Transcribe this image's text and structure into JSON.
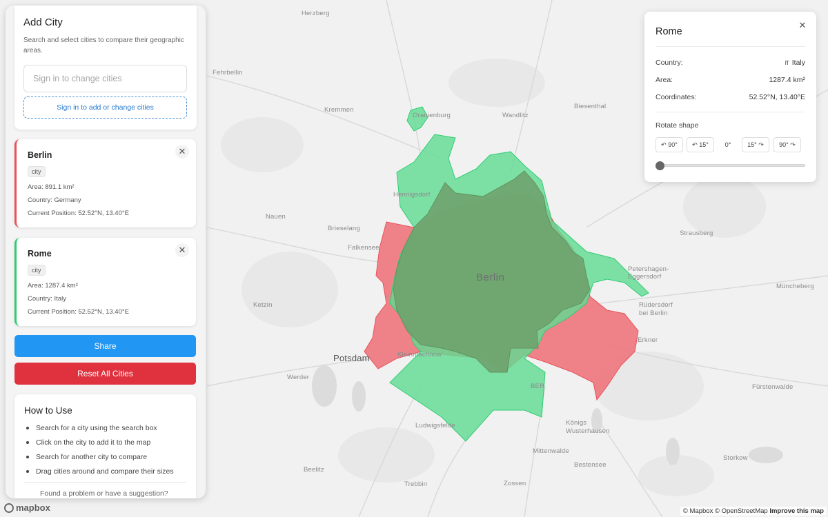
{
  "map": {
    "places": [
      {
        "name": "Herzberg",
        "cls": "place"
      },
      {
        "name": "Fehrbellin",
        "cls": "place"
      },
      {
        "name": "Kremmen",
        "cls": "place"
      },
      {
        "name": "Oranienburg",
        "cls": "place"
      },
      {
        "name": "Wandlitz",
        "cls": "place"
      },
      {
        "name": "Biesenthal",
        "cls": "place"
      },
      {
        "name": "Hennigsdorf",
        "cls": "place"
      },
      {
        "name": "Nauen",
        "cls": "place"
      },
      {
        "name": "Brieselang",
        "cls": "place"
      },
      {
        "name": "Falkensee",
        "cls": "place"
      },
      {
        "name": "Strausberg",
        "cls": "place"
      },
      {
        "name": "Petershagen-Eggersdorf",
        "cls": "place"
      },
      {
        "name": "Müncheberg",
        "cls": "place"
      },
      {
        "name": "Ketzin",
        "cls": "place"
      },
      {
        "name": "Rüdersdorf bei Berlin",
        "cls": "place"
      },
      {
        "name": "Erkner",
        "cls": "place"
      },
      {
        "name": "Potsdam",
        "cls": "place big"
      },
      {
        "name": "Kleinmachnow",
        "cls": "place"
      },
      {
        "name": "Werder",
        "cls": "place"
      },
      {
        "name": "BER",
        "cls": "place"
      },
      {
        "name": "Fürstenwalde",
        "cls": "place"
      },
      {
        "name": "Ludwigsfelde",
        "cls": "place"
      },
      {
        "name": "Königs Wusterhausen",
        "cls": "place"
      },
      {
        "name": "Mittenwalde",
        "cls": "place"
      },
      {
        "name": "Storkow",
        "cls": "place"
      },
      {
        "name": "Beelitz",
        "cls": "place"
      },
      {
        "name": "Bestensee",
        "cls": "place"
      },
      {
        "name": "Trebbin",
        "cls": "place"
      },
      {
        "name": "Zossen",
        "cls": "place"
      },
      {
        "name": "Berlin",
        "cls": "place city"
      }
    ],
    "berlin_color": "#ee6e76",
    "rome_color": "#5fdc92",
    "overlap_color": "#6fa46f",
    "attribution_mapbox": "© Mapbox",
    "attribution_osm": "© OpenStreetMap",
    "attribution_improve": "Improve this map",
    "logo_text": "mapbox",
    "logo_icon": "mapbox-logo-icon"
  },
  "add_city": {
    "title": "Add City",
    "description": "Search and select cities to compare their geographic areas.",
    "search_placeholder": "Sign in to change cities",
    "signin_label": "Sign in to add or change cities"
  },
  "cities": [
    {
      "name": "Berlin",
      "tag": "city",
      "area": "Area: 891.1 km²",
      "country": "Country: Germany",
      "position": "Current Position: 52.52°N, 13.40°E",
      "color": "#e8505b",
      "close": "✕"
    },
    {
      "name": "Rome",
      "tag": "city",
      "area": "Area: 1287.4 km²",
      "country": "Country: Italy",
      "position": "Current Position: 52.52°N, 13.40°E",
      "color": "#2ecc71",
      "close": "✕"
    }
  ],
  "actions": {
    "share_label": "Share",
    "reset_label": "Reset All Cities",
    "share_color": "#2196f3",
    "reset_color": "#e0323e"
  },
  "how_to": {
    "title": "How to Use",
    "steps": [
      "Search for a city using the search box",
      "Click on the city to add it to the map",
      "Search for another city to compare",
      "Drag cities around and compare their sizes"
    ],
    "feedback": "Found a problem or have a suggestion?"
  },
  "info_panel": {
    "title": "Rome",
    "close": "✕",
    "rows": [
      {
        "label": "Country:",
        "value": "Italy",
        "flag": "IT"
      },
      {
        "label": "Area:",
        "value": "1287.4 km²"
      },
      {
        "label": "Coordinates:",
        "value": "52.52°N, 13.40°E"
      }
    ],
    "rotate_label": "Rotate shape",
    "rotate_buttons": [
      "↶ 90°",
      "↶ 15°",
      "0°",
      "15° ↷",
      "90° ↷"
    ],
    "rotation_value": 0
  }
}
